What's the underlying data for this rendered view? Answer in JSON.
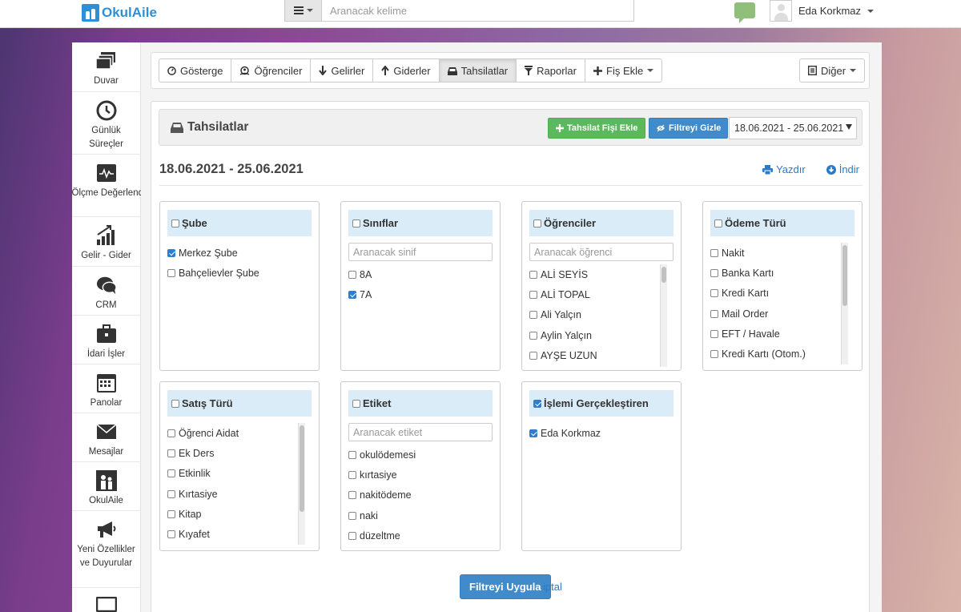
{
  "topbar": {
    "logo_text": "OkulAile",
    "search_placeholder": "Aranacak kelime",
    "user_name": "Eda Korkmaz"
  },
  "sidebar": {
    "items": [
      {
        "label": "Duvar",
        "icon": "wall-icon"
      },
      {
        "label": "Günlük Süreçler",
        "icon": "clock-icon"
      },
      {
        "label": "Ölçme Değerlendirme",
        "icon": "chart-monitor-icon"
      },
      {
        "label": "Gelir - Gider",
        "icon": "bar-growth-icon"
      },
      {
        "label": "CRM",
        "icon": "chat-bubbles-icon"
      },
      {
        "label": "İdari İşler",
        "icon": "briefcase-icon"
      },
      {
        "label": "Panolar",
        "icon": "calendar-icon"
      },
      {
        "label": "Mesajlar",
        "icon": "envelope-icon"
      },
      {
        "label": "OkulAile",
        "icon": "okulaile-icon"
      },
      {
        "label": "Yeni Özellikler ve Duyurular",
        "icon": "megaphone-icon"
      },
      {
        "label": "",
        "icon": "monitor-icon"
      }
    ]
  },
  "toolbar": {
    "buttons": [
      {
        "label": "Gösterge",
        "icon": "dashboard-icon"
      },
      {
        "label": "Öğrenciler",
        "icon": "students-icon"
      },
      {
        "label": "Gelirler",
        "icon": "arrow-down-icon"
      },
      {
        "label": "Giderler",
        "icon": "arrow-up-icon"
      },
      {
        "label": "Tahsilatlar",
        "icon": "inbox-icon"
      },
      {
        "label": "Raporlar",
        "icon": "filter-icon"
      },
      {
        "label": "Fiş Ekle",
        "icon": "plus-icon"
      }
    ],
    "more_label": "Diğer"
  },
  "panel": {
    "title": "Tahsilatlar",
    "add_button": "Tahsilat Fişi Ekle",
    "filter_toggle": "Filtreyi Gizle",
    "date_range_select": "18.06.2021 - 25.06.2021"
  },
  "range_title": "18.06.2021 - 25.06.2021",
  "actions": {
    "print": "Yazdır",
    "download": "İndir"
  },
  "filters": {
    "sube": {
      "title": "Şube",
      "checked": false,
      "items": [
        {
          "label": "Merkez Şube",
          "checked": true
        },
        {
          "label": "Bahçelievler Şube",
          "checked": false
        }
      ]
    },
    "siniflar": {
      "title": "Sınıflar",
      "checked": false,
      "search_placeholder": "Aranacak sinif",
      "items": [
        {
          "label": "8A",
          "checked": false
        },
        {
          "label": "7A",
          "checked": true
        }
      ]
    },
    "ogrenciler": {
      "title": "Öğrenciler",
      "checked": false,
      "search_placeholder": "Aranacak öğrenci",
      "items": [
        {
          "label": "ALİ SEYİS",
          "checked": false
        },
        {
          "label": "ALİ TOPAL",
          "checked": false
        },
        {
          "label": "Ali Yalçın",
          "checked": false
        },
        {
          "label": "Aylin Yalçın",
          "checked": false
        },
        {
          "label": "AYŞE UZUN",
          "checked": false
        }
      ]
    },
    "odeme_turu": {
      "title": "Ödeme Türü",
      "checked": false,
      "items": [
        {
          "label": "Nakit",
          "checked": false
        },
        {
          "label": "Banka Kartı",
          "checked": false
        },
        {
          "label": "Kredi Kartı",
          "checked": false
        },
        {
          "label": "Mail Order",
          "checked": false
        },
        {
          "label": "EFT / Havale",
          "checked": false
        },
        {
          "label": "Kredi Kartı (Otom.)",
          "checked": false
        }
      ]
    },
    "satis_turu": {
      "title": "Satış Türü",
      "checked": false,
      "items": [
        {
          "label": "Öğrenci Aidat",
          "checked": false
        },
        {
          "label": "Ek Ders",
          "checked": false
        },
        {
          "label": "Etkinlik",
          "checked": false
        },
        {
          "label": "Kırtasiye",
          "checked": false
        },
        {
          "label": "Kitap",
          "checked": false
        },
        {
          "label": "Kıyafet",
          "checked": false
        }
      ]
    },
    "etiket": {
      "title": "Etiket",
      "checked": false,
      "search_placeholder": "Aranacak etiket",
      "items": [
        {
          "label": "okulödemesi",
          "checked": false
        },
        {
          "label": "kırtasiye",
          "checked": false
        },
        {
          "label": "nakitödeme",
          "checked": false
        },
        {
          "label": "naki",
          "checked": false
        },
        {
          "label": "düzeltme",
          "checked": false
        }
      ]
    },
    "islemi_gerceklestiren": {
      "title": "İşlemi Gerçekleştiren",
      "checked": true,
      "items": [
        {
          "label": "Eda Korkmaz",
          "checked": true
        }
      ]
    }
  },
  "footer": {
    "apply": "Filtreyi Uygula",
    "cancel": "iptal"
  },
  "colors": {
    "primary": "#428bca",
    "success": "#5cb85c",
    "filter_header": "#d9ecf8",
    "brand": "#2f8fd6"
  }
}
